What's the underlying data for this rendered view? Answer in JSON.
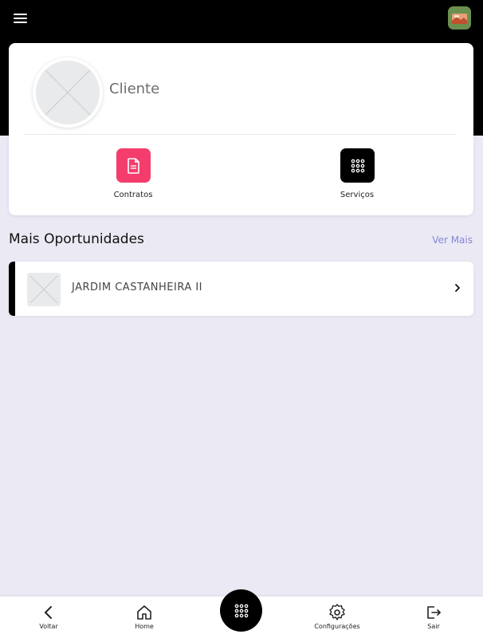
{
  "header": {
    "menu_icon": "hamburger-menu-icon",
    "avatar_icon": "user-avatar-icon",
    "background_color": "#000000"
  },
  "profile": {
    "name": "Cliente",
    "avatar_icon": "placeholder-image-icon",
    "actions": [
      {
        "label": "Contratos",
        "icon": "document-icon",
        "color": "#f43d6d"
      },
      {
        "label": "Serviços",
        "icon": "grid-dots-icon",
        "color": "#000000"
      }
    ]
  },
  "opportunities": {
    "title": "Mais Oportunidades",
    "see_more": "Ver Mais",
    "see_more_color": "#8a85d8",
    "items": [
      {
        "title": "JARDIM CASTANHEIRA II",
        "thumb_icon": "placeholder-image-icon"
      }
    ]
  },
  "bottom_nav": {
    "items": [
      {
        "label": "Voltar",
        "icon": "chevron-left-icon"
      },
      {
        "label": "Home",
        "icon": "home-icon"
      },
      {
        "label": "Configurações",
        "icon": "gear-icon"
      },
      {
        "label": "Sair",
        "icon": "logout-icon"
      }
    ],
    "fab_icon": "grid-dots-icon"
  },
  "colors": {
    "background": "#eae9f4",
    "accent_pink": "#f43d6d",
    "accent_purple": "#8a85d8"
  }
}
